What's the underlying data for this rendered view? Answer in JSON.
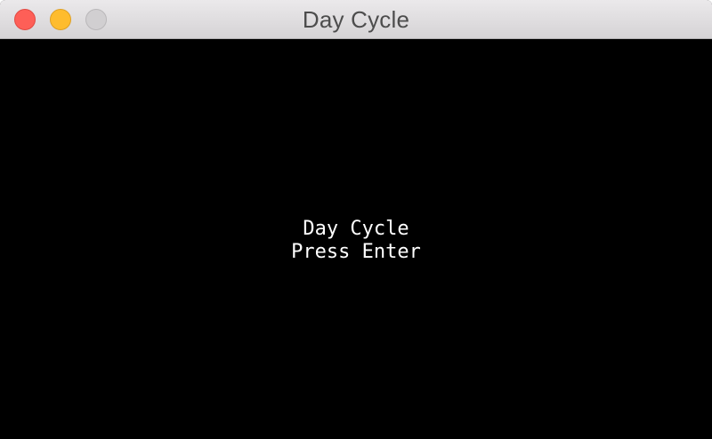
{
  "window": {
    "title": "Day Cycle",
    "controls": {
      "close": "close-icon",
      "minimize": "minimize-icon",
      "zoom": "zoom-icon"
    }
  },
  "screen": {
    "title": "Day Cycle",
    "prompt": "Press Enter"
  },
  "colors": {
    "background": "#000000",
    "text": "#ffffff",
    "close": "#fe5f57",
    "minimize": "#febc2e",
    "zoom_inactive": "#d1cfd1"
  }
}
